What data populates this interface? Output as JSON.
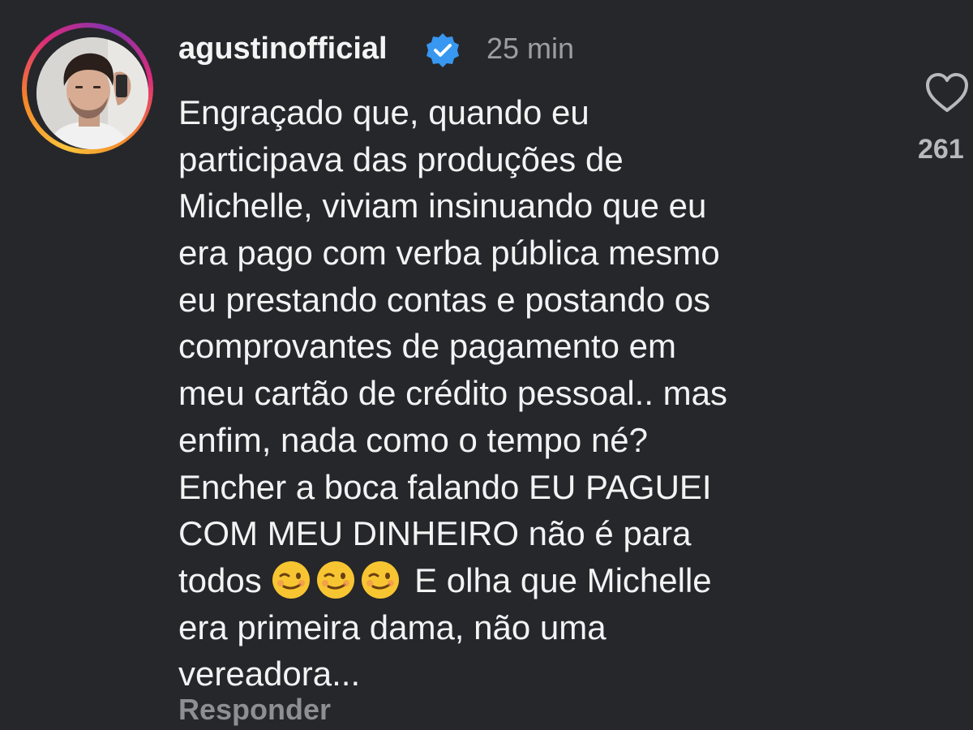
{
  "comment": {
    "username": "agustinofficial",
    "verified_icon": "verified-badge-icon",
    "timestamp": "25 min",
    "text_lines": [
      "Engraçado que, quando eu",
      "participava das produções de",
      "Michelle, viviam insinuando que eu",
      "era pago com verba pública mesmo",
      "eu prestando contas e postando os",
      "comprovantes de pagamento em",
      "meu cartão de crédito pessoal.. mas",
      "enfim, nada como o tempo né?",
      "Encher a boca falando EU PAGUEI",
      "COM MEU DINHEIRO não é para"
    ],
    "emoji_line_before": "todos",
    "emoji_name": "winking-face-emoji",
    "emoji_line_after": "E olha que Michelle",
    "text_lines_end": [
      "era primeira dama, não uma",
      "vereadora..."
    ],
    "reply_label": "Responder",
    "like_icon": "heart-outline-icon",
    "like_count": "261"
  },
  "colors": {
    "background": "#26272b",
    "text": "#f3f3f3",
    "muted": "#9d9da3",
    "verified_blue": "#3897f0"
  }
}
